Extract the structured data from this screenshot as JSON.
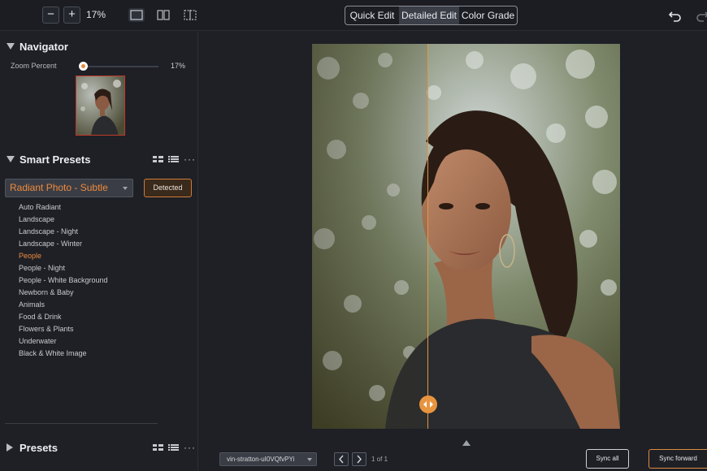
{
  "toolbar": {
    "zoom_out_label": "−",
    "zoom_in_label": "+",
    "zoom_value": "17%",
    "view_modes": [
      "single-view-icon",
      "split-view-icon",
      "crop-view-icon"
    ],
    "modes": [
      {
        "label": "Quick Edit",
        "active": false
      },
      {
        "label": "Detailed Edit",
        "active": true
      },
      {
        "label": "Color Grade",
        "active": false
      }
    ]
  },
  "navigator": {
    "title": "Navigator",
    "zoom_label": "Zoom Percent",
    "zoom_value": "17%",
    "zoom_level": 0.17
  },
  "smart_presets": {
    "title": "Smart Presets",
    "selected": "Radiant Photo - Subtle",
    "detected_label": "Detected",
    "items": [
      "Auto Radiant",
      "Landscape",
      "Landscape - Night",
      "Landscape - Winter",
      "People",
      "People - Night",
      "People - White Background",
      "Newborn & Baby",
      "Animals",
      "Food & Drink",
      "Flowers & Plants",
      "Underwater",
      "Black & White Image"
    ],
    "selected_item_index": 4
  },
  "presets": {
    "title": "Presets"
  },
  "footer": {
    "file_name": "vin-stratton-uI0VQfvPYi",
    "page_info": "1 of 1",
    "sync_all": "Sync all",
    "sync_forward": "Sync forward"
  },
  "colors": {
    "accent": "#e8953f",
    "background": "#1e2026",
    "selected_text": "#f08a3c"
  }
}
